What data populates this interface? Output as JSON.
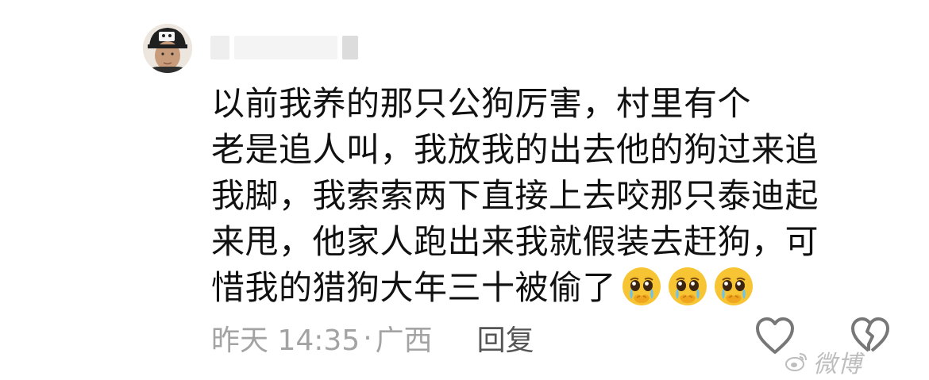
{
  "comment": {
    "lines": [
      "以前我养的那只公狗厉害，村里有个",
      "老是追人叫，我放我的出去他的狗过来追",
      "我脚，我索索两下直接上去咬那只泰迪起",
      "来甩，他家人跑出来我就假装去赶狗，可",
      "惜我的猎狗大年三十被偷了"
    ],
    "emojis": [
      "pleading-crying-face",
      "pleading-crying-face",
      "pleading-crying-face"
    ]
  },
  "meta": {
    "time": "昨天 14:35",
    "separator": "·",
    "location": "广西",
    "reply_label": "回复"
  },
  "icons": {
    "avatar": "user-avatar",
    "like": "heart-outline-icon",
    "dislike": "broken-heart-outline-icon"
  },
  "watermark": {
    "text": "微博"
  },
  "colors": {
    "text": "#111111",
    "meta": "#a3a3a3",
    "reply": "#555555",
    "icon_stroke": "#777777"
  }
}
